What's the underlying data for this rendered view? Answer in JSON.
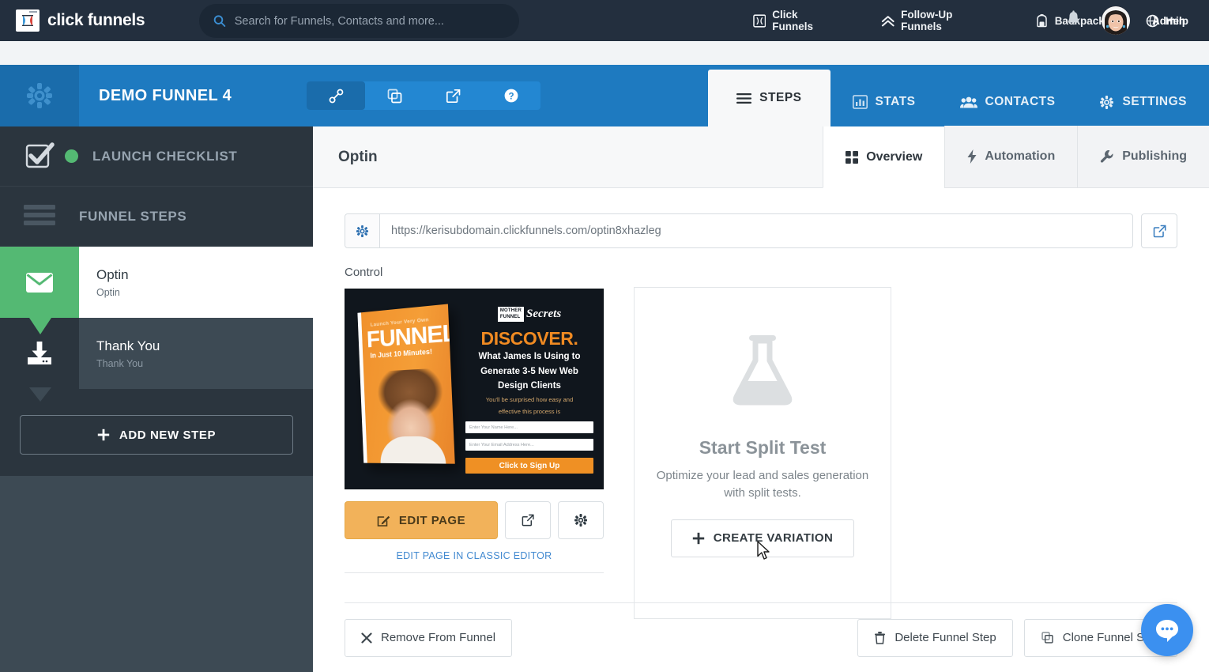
{
  "topbar": {
    "brand": "click funnels",
    "search": {
      "placeholder": "Search for Funnels, Contacts and more...",
      "value": ""
    },
    "nav": [
      {
        "label": "Click Funnels",
        "icon": "clickfunnels-icon"
      },
      {
        "label": "Follow-Up Funnels",
        "icon": "chevrons-up-icon"
      },
      {
        "label": "Backpack",
        "icon": "backpack-icon"
      },
      {
        "label": "Help",
        "icon": "help-globe-icon"
      }
    ],
    "notifications_icon": "bell-icon",
    "avatar_icon": "user-avatar",
    "admin_label": "Admin"
  },
  "funnel_header": {
    "gear_icon": "gear-icon",
    "title": "DEMO FUNNEL 4",
    "actions": [
      {
        "icon": "link-icon",
        "active": true
      },
      {
        "icon": "clone-icon",
        "active": false
      },
      {
        "icon": "external-link-icon",
        "active": false
      },
      {
        "icon": "question-circle-icon",
        "active": false
      }
    ],
    "tabs": [
      {
        "label": "STEPS",
        "icon": "hamburger-icon",
        "active": true
      },
      {
        "label": "STATS",
        "icon": "bar-chart-icon",
        "active": false
      },
      {
        "label": "CONTACTS",
        "icon": "users-icon",
        "active": false
      },
      {
        "label": "SETTINGS",
        "icon": "gear-icon",
        "active": false
      }
    ]
  },
  "sidebar": {
    "launch_checklist": {
      "label": "LAUNCH CHECKLIST",
      "icon": "checkbox-icon",
      "status_color": "#54b973"
    },
    "funnel_steps": {
      "label": "FUNNEL STEPS",
      "icon": "list-icon"
    },
    "steps": [
      {
        "title": "Optin",
        "subtitle": "Optin",
        "icon": "envelope-icon",
        "active": true
      },
      {
        "title": "Thank You",
        "subtitle": "Thank You",
        "icon": "download-inbox-icon",
        "active": false
      }
    ],
    "add_new_step": {
      "label": "ADD NEW STEP",
      "icon": "plus-icon"
    }
  },
  "step_panel": {
    "name": "Optin",
    "tabs": [
      {
        "label": "Overview",
        "icon": "grid-icon",
        "active": true
      },
      {
        "label": "Automation",
        "icon": "bolt-icon",
        "active": false
      },
      {
        "label": "Publishing",
        "icon": "wrench-icon",
        "active": false
      }
    ],
    "url": {
      "gear_icon": "gear-icon",
      "value": "https://kerisubdomain.clickfunnels.com/optin8xhazleg",
      "open_icon": "external-link-icon"
    },
    "control": {
      "label": "Control",
      "thumbnail": {
        "book_line1": "Launch Your Very Own",
        "book_line2": "FUNNEL",
        "book_line3": "In Just 10 Minutes!",
        "logo_line1": "MOTHER",
        "logo_line2": "FUNNEL",
        "logo_script": "Secrets",
        "headline": "DISCOVER.",
        "subhead_line1": "What James Is Using to",
        "subhead_line2": "Generate 3-5 New Web",
        "subhead_line3": "Design Clients",
        "small_line1": "You'll be surprised how easy and",
        "small_line2": "effective this process is",
        "input_name_placeholder": "Enter Your Name Here...",
        "input_email_placeholder": "Enter Your Email Address Here...",
        "cta": "Click to Sign Up"
      },
      "edit_page": {
        "label": "EDIT PAGE",
        "icon": "edit-pencil-icon"
      },
      "preview_icon": "external-link-icon",
      "settings_icon": "gear-icon",
      "classic_editor_link": "EDIT PAGE IN CLASSIC EDITOR"
    },
    "split_test": {
      "icon": "flask-icon",
      "title": "Start Split Test",
      "description": "Optimize your lead and sales generation with split tests.",
      "create_button": {
        "label": "CREATE VARIATION",
        "icon": "plus-icon"
      }
    },
    "footer_actions": {
      "remove": {
        "label": "Remove From Funnel",
        "icon": "x-icon"
      },
      "delete": {
        "label": "Delete Funnel Step",
        "icon": "trash-icon"
      },
      "clone": {
        "label": "Clone Funnel Step",
        "icon": "clone-icon"
      }
    }
  },
  "chat_widget": {
    "icon": "chat-bubble-icon",
    "color": "#3b90f0"
  },
  "colors": {
    "topbar_bg": "#232f3e",
    "funnel_header_bg": "#1e7ac0",
    "sidebar_bg": "#3d4a54",
    "sidebar_dark": "#2b353e",
    "accent_green": "#54b973",
    "accent_orange": "#f2b25a",
    "link_blue": "#4189d0"
  }
}
